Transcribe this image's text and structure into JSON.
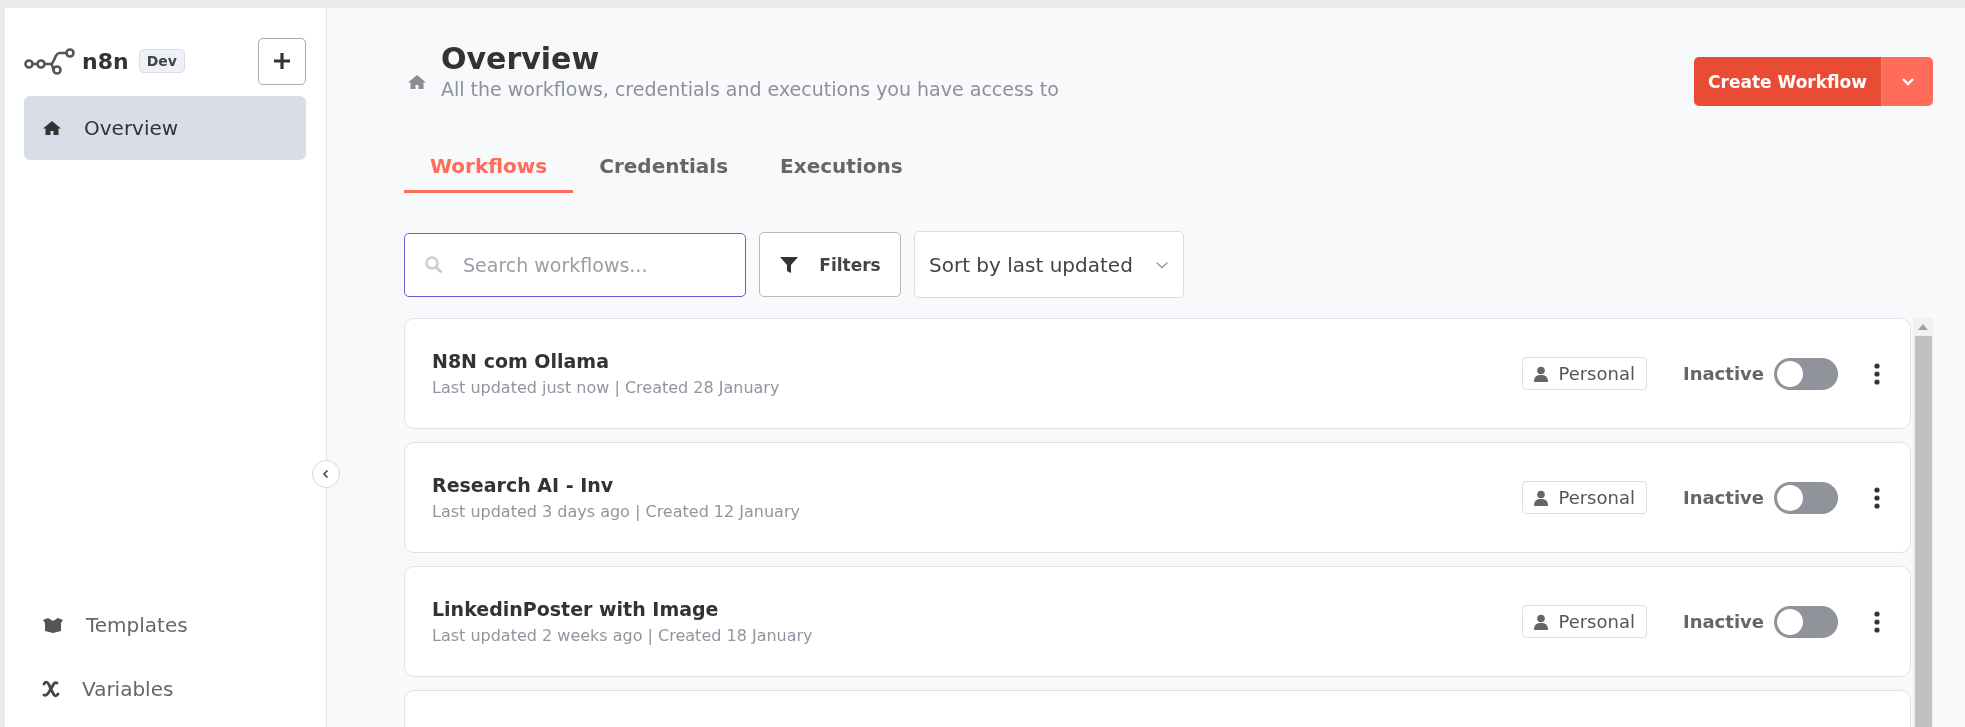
{
  "sidebar": {
    "logo": "n8n",
    "badge": "Dev",
    "items": [
      {
        "label": "Overview",
        "selected": true
      }
    ],
    "bottom_items": [
      {
        "label": "Templates"
      },
      {
        "label": "Variables"
      }
    ]
  },
  "header": {
    "title": "Overview",
    "subtitle": "All the workflows, credentials and executions you have access to"
  },
  "create_button": "Create Workflow",
  "tabs": [
    {
      "label": "Workflows",
      "selected": true
    },
    {
      "label": "Credentials",
      "selected": false
    },
    {
      "label": "Executions",
      "selected": false
    }
  ],
  "search": {
    "placeholder": "Search workflows..."
  },
  "filters_button": "Filters",
  "sort": {
    "value": "Sort by last updated"
  },
  "workflows": [
    {
      "name": "N8N com Ollama",
      "meta": "Last updated just now | Created 28 January",
      "owner": "Personal",
      "status": "Inactive",
      "active": false
    },
    {
      "name": "Research AI - Inv",
      "meta": "Last updated 3 days ago | Created 12 January",
      "owner": "Personal",
      "status": "Inactive",
      "active": false
    },
    {
      "name": "LinkedinPoster with Image",
      "meta": "Last updated 2 weeks ago | Created 18 January",
      "owner": "Personal",
      "status": "Inactive",
      "active": false
    }
  ]
}
